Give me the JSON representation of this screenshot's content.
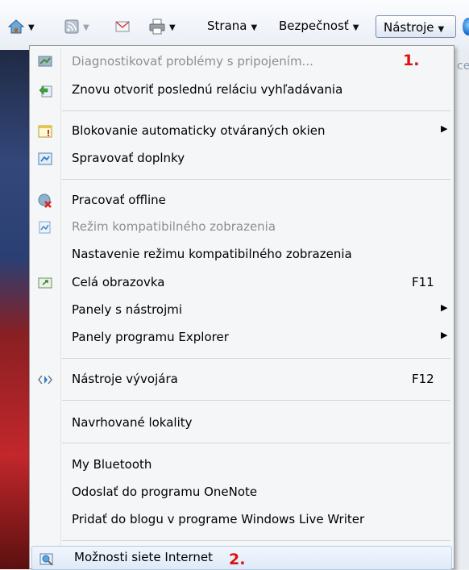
{
  "toolbar": {
    "home_icon": "home-icon",
    "feeds_icon": "feeds-icon",
    "mail_icon": "mail-icon",
    "print_icon": "print-icon",
    "strana_label": "Strana",
    "bezpecnost_label": "Bezpečnosť",
    "nastroje_label": "Nástroje"
  },
  "page": {
    "partial_text": "ce"
  },
  "menu": {
    "items": [
      {
        "label": "Diagnostikovať problémy s pripojením...",
        "disabled": true,
        "icon": "diagnose-icon"
      },
      {
        "label": "Znovu otvoriť poslednú reláciu vyhľadávania",
        "icon": "reopen-session-icon"
      },
      {
        "label": "Blokovanie automaticky otváraných okien",
        "icon": "popup-blocker-icon",
        "submenu": true
      },
      {
        "label": "Spravovať doplnky",
        "icon": "addons-icon"
      },
      {
        "label": "Pracovať offline",
        "icon": "offline-icon"
      },
      {
        "label": "Režim kompatibilného zobrazenia",
        "disabled": true,
        "icon": "compatibility-icon"
      },
      {
        "label": "Nastavenie režimu kompatibilného zobrazenia"
      },
      {
        "label": "Celá obrazovka",
        "icon": "fullscreen-icon",
        "shortcut": "F11"
      },
      {
        "label": "Panely s nástrojmi",
        "submenu": true
      },
      {
        "label": "Panely programu Explorer",
        "submenu": true
      },
      {
        "label": "Nástroje vývojára",
        "icon": "developer-tools-icon",
        "shortcut": "F12"
      },
      {
        "label": "Navrhované lokality"
      },
      {
        "label": "My Bluetooth"
      },
      {
        "label": "Odoslať do programu OneNote"
      },
      {
        "label": "Pridať do blogu v programe Windows Live Writer"
      },
      {
        "label": "Možnosti siete Internet",
        "icon": "internet-options-icon",
        "highlighted": true
      }
    ]
  },
  "annotations": {
    "first": "1.",
    "second": "2."
  }
}
